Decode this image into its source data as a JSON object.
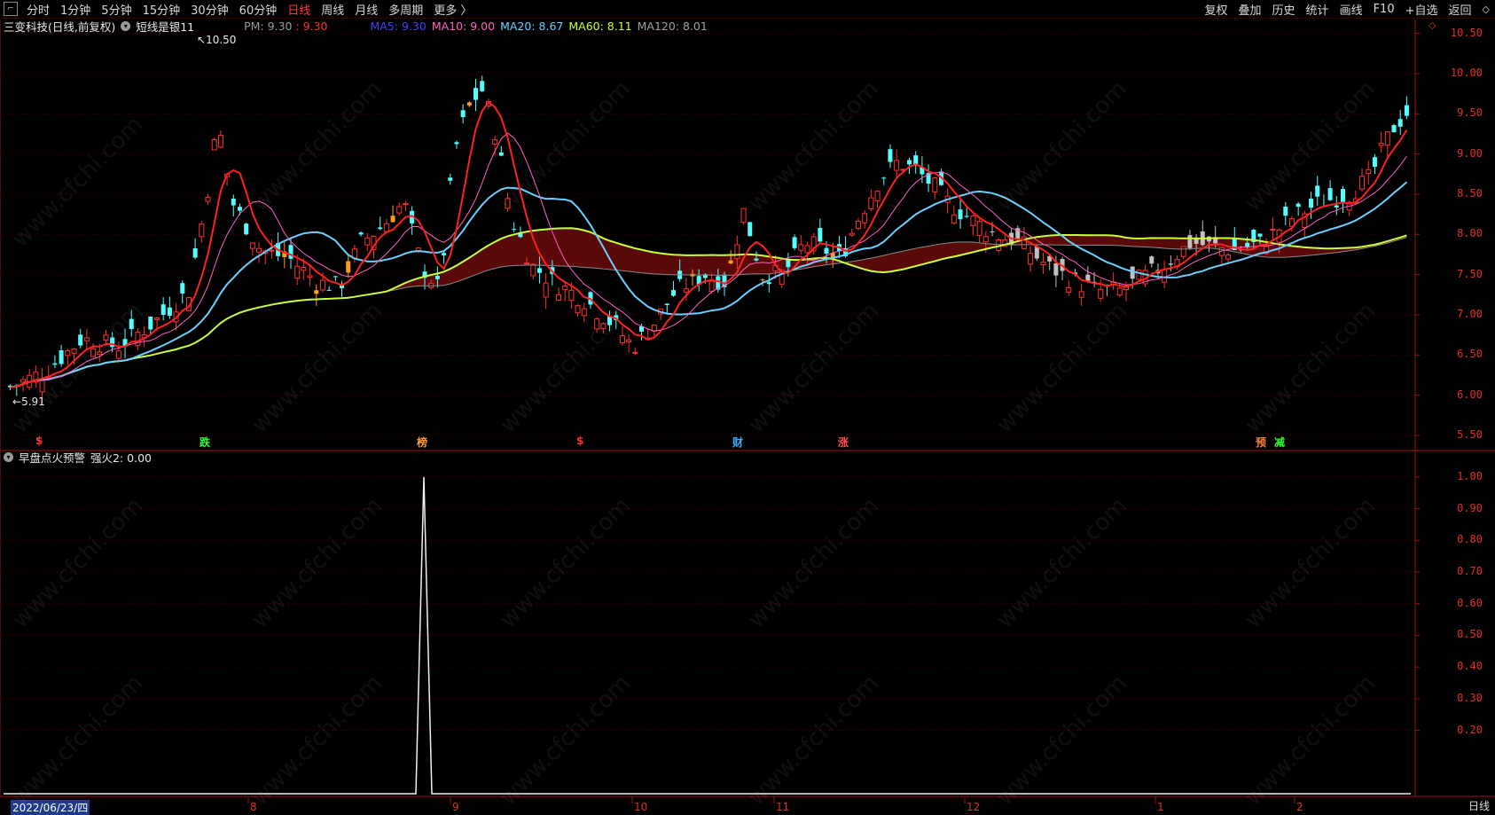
{
  "toolbar": {
    "periods": [
      "分时",
      "1分钟",
      "5分钟",
      "15分钟",
      "30分钟",
      "60分钟",
      "日线",
      "周线",
      "月线",
      "多周期",
      "更多 〉"
    ],
    "active_period": "日线",
    "right_items": [
      "复权",
      "叠加",
      "历史",
      "统计",
      "画线",
      "F10",
      "+自选",
      "返回"
    ]
  },
  "main_panel": {
    "title": "三变科技(日线,前复权)",
    "indicator": "短线是银11",
    "pm_label": "PM: 9.30",
    "pm_value": ": 9.30",
    "ma": [
      {
        "label": "MA5: 9.30",
        "color": "#4040ff"
      },
      {
        "label": "MA10: 9.00",
        "color": "#ff60c0"
      },
      {
        "label": "MA20: 8.67",
        "color": "#6ad0ff"
      },
      {
        "label": "MA60: 8.11",
        "color": "#c8ff3a"
      },
      {
        "label": "MA120: 8.01",
        "color": "#a0a0a0"
      }
    ],
    "y_labels": [
      "10.50",
      "10.00",
      "9.50",
      "9.00",
      "8.50",
      "8.00",
      "7.50",
      "7.00",
      "6.50",
      "6.00",
      "5.50"
    ],
    "high_label": "10.50",
    "low_label": "5.91",
    "markers": [
      {
        "text": "$",
        "color": "#ff3030"
      },
      {
        "text": "跌",
        "color": "#30ff30"
      },
      {
        "text": "榜",
        "color": "#ff9a30"
      },
      {
        "text": "$",
        "color": "#ff3030"
      },
      {
        "text": "财",
        "color": "#30b0ff"
      },
      {
        "text": "涨",
        "color": "#ff5050"
      },
      {
        "text": "预",
        "color": "#ff8030"
      },
      {
        "text": "减",
        "color": "#30ff30"
      }
    ]
  },
  "sub_panel": {
    "title": "早盘点火预警",
    "value": "强火2: 0.00",
    "y_labels": [
      "1.00",
      "0.90",
      "0.80",
      "0.70",
      "0.60",
      "0.50",
      "0.40",
      "0.30",
      "0.20"
    ]
  },
  "x_axis": {
    "first_date": "2022/06/23/四",
    "labels": [
      "8",
      "9",
      "10",
      "11",
      "12",
      "1",
      "2"
    ]
  },
  "period_button": "日线",
  "watermark": "www.cfchi.com",
  "chart_data": {
    "type": "candlestick",
    "title": "三变科技(日线,前复权)",
    "ylim": [
      5.4,
      10.65
    ],
    "max_price": 10.5,
    "min_price": 5.91,
    "sub_chart": {
      "name": "强火2",
      "peak_value": 1.0,
      "current_value": 0.0,
      "ylim": [
        0,
        1.05
      ]
    }
  }
}
